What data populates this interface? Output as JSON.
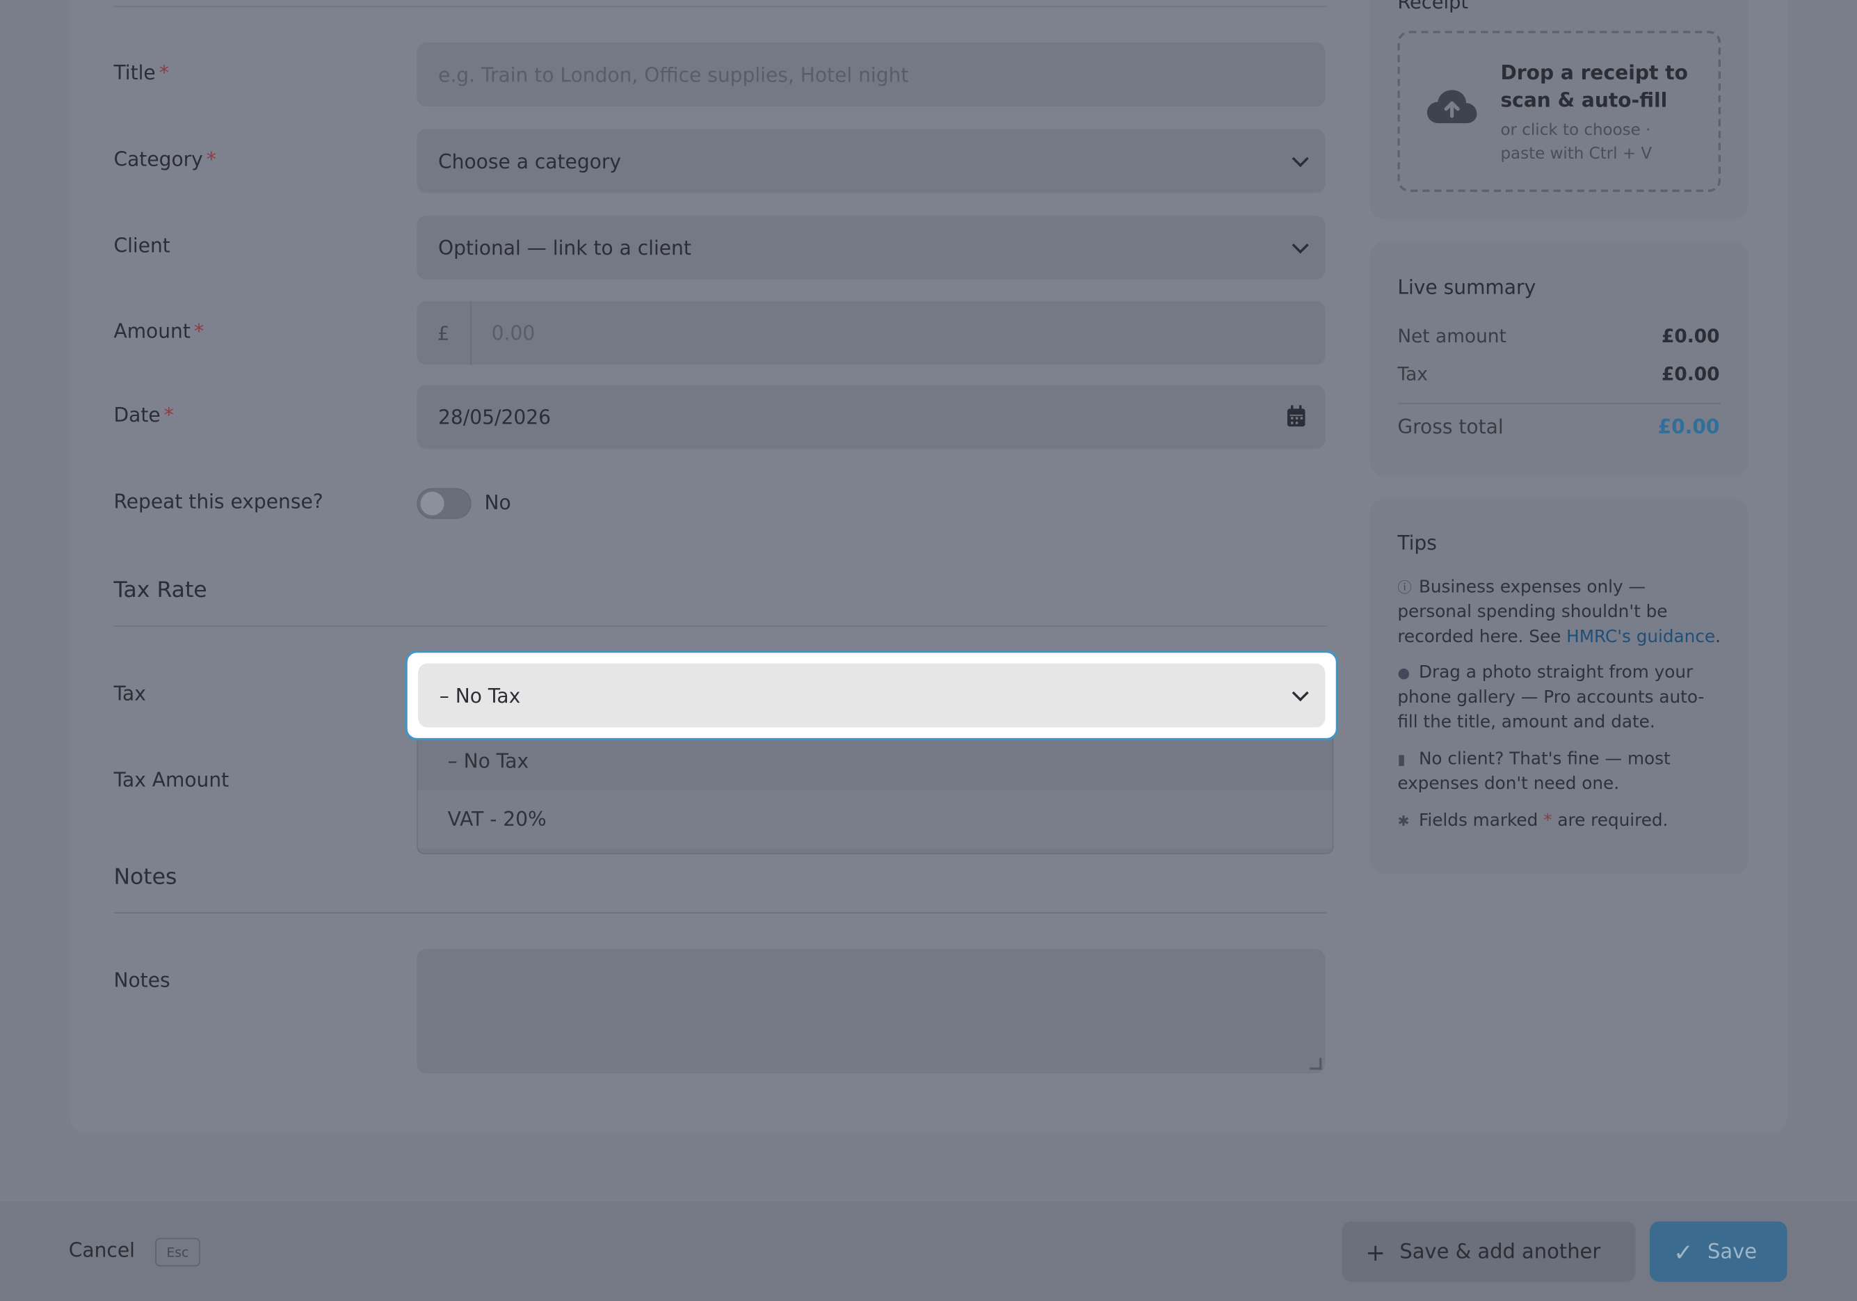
{
  "form": {
    "title": {
      "label": "Title",
      "placeholder": "e.g. Train to London, Office supplies, Hotel night"
    },
    "category": {
      "label": "Category",
      "value": "Choose a category"
    },
    "client": {
      "label": "Client",
      "value": "Optional — link to a client"
    },
    "amount": {
      "label": "Amount",
      "currency": "£",
      "placeholder": "0.00"
    },
    "date": {
      "label": "Date",
      "value": "28/05/2026"
    },
    "repeat": {
      "label": "Repeat this expense?",
      "state": "No"
    },
    "required_mark": "*",
    "tax_section": {
      "heading": "Tax Rate",
      "tax_label": "Tax",
      "tax_selected": "– No Tax",
      "tax_options": [
        "– No Tax",
        "VAT - 20%"
      ],
      "tax_amount_label": "Tax Amount"
    },
    "notes_section": {
      "heading": "Notes",
      "notes_label": "Notes"
    }
  },
  "sidebar": {
    "receipt": {
      "heading": "Receipt",
      "title": "Drop a receipt to scan & auto-fill",
      "subtitle": "or click to choose · paste with Ctrl + V"
    },
    "summary": {
      "heading": "Live summary",
      "net_label": "Net amount",
      "net_value": "£0.00",
      "tax_label": "Tax",
      "tax_value": "£0.00",
      "gross_label": "Gross total",
      "gross_value": "£0.00"
    },
    "tips": {
      "heading": "Tips",
      "tip1_text": "Business expenses only — personal spending shouldn't be recorded here. See",
      "tip1_link": "HMRC's guidance",
      "tip1_end": ".",
      "tip2": "Drag a photo straight from your phone gallery — Pro accounts auto-fill the title, amount and date.",
      "tip3": "No client? That's fine — most expenses don't need one.",
      "tip4_start": "Fields marked",
      "tip4_star": "*",
      "tip4_end": "are required."
    }
  },
  "footer": {
    "cancel_label": "Cancel",
    "cancel_shortcut": "Esc",
    "save_add_label": "Save & add another",
    "save_label": "Save"
  },
  "colors": {
    "accent": "#3e95c6",
    "required": "#8a3d45",
    "primary_button": "#3b6b8e"
  }
}
